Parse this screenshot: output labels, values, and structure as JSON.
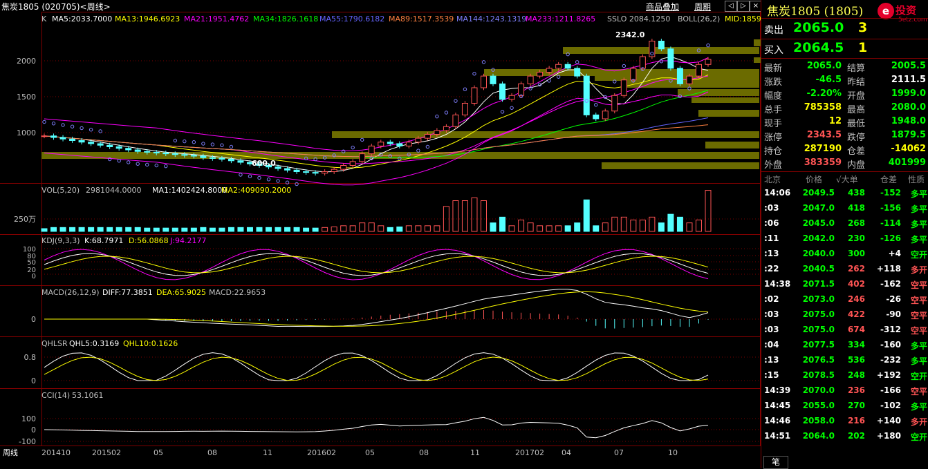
{
  "titlebar": {
    "title": "焦炭1805 (020705)<周线>",
    "btn_overlay": "商品叠加",
    "btn_period": "周期",
    "nav_left": "◁",
    "nav_right": "▷",
    "nav_close": "×"
  },
  "main_indicator": {
    "prefix": "K",
    "items": [
      {
        "text": "MA5:2033.7000",
        "color": "#ffffff"
      },
      {
        "text": "MA13:1946.6923",
        "color": "#ffff00"
      },
      {
        "text": "MA21:1951.4762",
        "color": "#ff00ff"
      },
      {
        "text": "MA34:1826.1618",
        "color": "#00ff00"
      },
      {
        "text": "MA55:1790.6182",
        "color": "#6464ff"
      },
      {
        "text": "MA89:1517.3539",
        "color": "#ff8040"
      },
      {
        "text": "MA144:1243.1319",
        "color": "#8080ff"
      },
      {
        "text": "MA233:1211.8265",
        "color": "#ff00ff"
      },
      {
        "text": "SSLO 2084.1250",
        "color": "#c0c0c0"
      },
      {
        "text": "BOLL(26,2)",
        "color": "#c0c0c0"
      },
      {
        "text": "MID:1859",
        "color": "#ffff00"
      }
    ],
    "yticks": [
      "2000",
      "1500",
      "1000"
    ],
    "annot_high": "2342.0",
    "annot_low": "600.0"
  },
  "vol": {
    "label": "VOL(5,20)",
    "v": "2981044.0000",
    "ma1": "MA1:1402424.8000",
    "ma2": "MA2:409090.2000",
    "ytick": "250万"
  },
  "kdj": {
    "label": "KDJ(9,3,3)",
    "k": "K:68.7971",
    "d": "D:56.0868",
    "j": "J:94.2177",
    "yticks": [
      "100",
      "80",
      "50",
      "20",
      "0"
    ]
  },
  "macd": {
    "label": "MACD(26,12,9)",
    "diff": "DIFF:77.3851",
    "dea": "DEA:65.9025",
    "macd": "MACD:22.9653",
    "ytick": "0"
  },
  "qhlsr": {
    "label": "QHLSR",
    "q5": "QHL5:0.3169",
    "q10": "QHL10:0.1626",
    "yticks": [
      "0.8",
      "0"
    ]
  },
  "cci": {
    "label": "CCI(14)",
    "val": "53.1061",
    "yticks": [
      "100",
      "0",
      "-100"
    ]
  },
  "xaxis": {
    "period": "周线",
    "labels": [
      "201410",
      "201502",
      "05",
      "08",
      "11",
      "201602",
      "05",
      "08",
      "11",
      "201702",
      "04",
      "07",
      "10"
    ]
  },
  "chart_data": {
    "type": "candlestick",
    "symbol": "焦炭1805",
    "period": "周线",
    "ylim": [
      500,
      2500
    ],
    "high_mark": 2342.0,
    "low_mark": 600.0,
    "close_path": [
      1080,
      1060,
      1040,
      1020,
      1000,
      980,
      960,
      940,
      920,
      900,
      880,
      870,
      860,
      850,
      840,
      830,
      820,
      800,
      790,
      780,
      760,
      740,
      720,
      700,
      680,
      660,
      640,
      620,
      610,
      600,
      620,
      650,
      700,
      750,
      850,
      950,
      1000,
      980,
      950,
      1000,
      1050,
      1100,
      1150,
      1200,
      1350,
      1500,
      1700,
      1850,
      1750,
      1550,
      1600,
      1750,
      1850,
      1900,
      1950,
      2000,
      1950,
      1850,
      1350,
      1300,
      1400,
      1600,
      1800,
      1950,
      2100,
      2300,
      2200,
      1950,
      1750,
      1850,
      2000,
      2065
    ]
  },
  "panel": {
    "name": "焦炭1805 (1805)",
    "logo_text": "投资",
    "logo_url": "5etz.com",
    "sell_label": "卖出",
    "sell_price": "2065.0",
    "sell_vol": "3",
    "buy_label": "买入",
    "buy_price": "2064.5",
    "buy_vol": "1",
    "quotes": [
      {
        "l1": "最新",
        "v1": "2065.0",
        "c1": "g",
        "l2": "结算",
        "v2": "2005.5",
        "c2": "g"
      },
      {
        "l1": "涨跌",
        "v1": "-46.5",
        "c1": "g",
        "l2": "昨结",
        "v2": "2111.5",
        "c2": "w"
      },
      {
        "l1": "幅度",
        "v1": "-2.20%",
        "c1": "g",
        "l2": "开盘",
        "v2": "1999.0",
        "c2": "g"
      },
      {
        "l1": "总手",
        "v1": "785358",
        "c1": "y",
        "l2": "最高",
        "v2": "2080.0",
        "c2": "g"
      },
      {
        "l1": "现手",
        "v1": "12",
        "c1": "y",
        "l2": "最低",
        "v2": "1948.0",
        "c2": "g"
      },
      {
        "l1": "涨停",
        "v1": "2343.5",
        "c1": "r",
        "l2": "跌停",
        "v2": "1879.5",
        "c2": "g"
      },
      {
        "l1": "持仓",
        "v1": "287190",
        "c1": "y",
        "l2": "仓差",
        "v2": "-14062",
        "c2": "y"
      },
      {
        "l1": "外盘",
        "v1": "383359",
        "c1": "r",
        "l2": "内盘",
        "v2": "401999",
        "c2": "g"
      }
    ],
    "thead": {
      "c1": "北京",
      "c2": "价格",
      "c3": "√大单",
      "c4": "仓差",
      "c5": "性质"
    },
    "trades": [
      {
        "t": "14:06",
        "p": "2049.5",
        "pc": "g",
        "v": "438",
        "vc": "g",
        "d": "-152",
        "dc": "g",
        "n": "多平",
        "nc": "g"
      },
      {
        "t": ":03",
        "p": "2047.0",
        "pc": "g",
        "v": "418",
        "vc": "g",
        "d": "-156",
        "dc": "g",
        "n": "多平",
        "nc": "g"
      },
      {
        "t": ":06",
        "p": "2045.0",
        "pc": "g",
        "v": "268",
        "vc": "g",
        "d": "-114",
        "dc": "g",
        "n": "多平",
        "nc": "g"
      },
      {
        "t": ":11",
        "p": "2042.0",
        "pc": "g",
        "v": "230",
        "vc": "g",
        "d": "-126",
        "dc": "g",
        "n": "多平",
        "nc": "g"
      },
      {
        "t": ":13",
        "p": "2040.0",
        "pc": "g",
        "v": "300",
        "vc": "g",
        "d": "+4",
        "dc": "w",
        "n": "空开",
        "nc": "g"
      },
      {
        "t": ":22",
        "p": "2040.5",
        "pc": "g",
        "v": "262",
        "vc": "r",
        "d": "+118",
        "dc": "w",
        "n": "多开",
        "nc": "r"
      },
      {
        "t": "14:38",
        "p": "2071.5",
        "pc": "g",
        "v": "402",
        "vc": "r",
        "d": "-162",
        "dc": "w",
        "n": "空平",
        "nc": "r"
      },
      {
        "t": ":02",
        "p": "2073.0",
        "pc": "g",
        "v": "246",
        "vc": "r",
        "d": "-26",
        "dc": "w",
        "n": "空平",
        "nc": "r"
      },
      {
        "t": ":03",
        "p": "2075.0",
        "pc": "g",
        "v": "422",
        "vc": "r",
        "d": "-90",
        "dc": "w",
        "n": "空平",
        "nc": "r"
      },
      {
        "t": ":03",
        "p": "2075.0",
        "pc": "g",
        "v": "674",
        "vc": "r",
        "d": "-312",
        "dc": "w",
        "n": "空平",
        "nc": "r"
      },
      {
        "t": ":04",
        "p": "2077.5",
        "pc": "g",
        "v": "334",
        "vc": "g",
        "d": "-160",
        "dc": "w",
        "n": "多平",
        "nc": "g"
      },
      {
        "t": ":13",
        "p": "2076.5",
        "pc": "g",
        "v": "536",
        "vc": "g",
        "d": "-232",
        "dc": "w",
        "n": "多平",
        "nc": "g"
      },
      {
        "t": ":15",
        "p": "2078.5",
        "pc": "g",
        "v": "248",
        "vc": "g",
        "d": "+192",
        "dc": "w",
        "n": "空开",
        "nc": "g"
      },
      {
        "t": "14:39",
        "p": "2070.0",
        "pc": "g",
        "v": "236",
        "vc": "r",
        "d": "-166",
        "dc": "w",
        "n": "空平",
        "nc": "r"
      },
      {
        "t": "14:45",
        "p": "2055.0",
        "pc": "g",
        "v": "270",
        "vc": "g",
        "d": "-102",
        "dc": "w",
        "n": "多平",
        "nc": "g"
      },
      {
        "t": "14:46",
        "p": "2058.0",
        "pc": "g",
        "v": "216",
        "vc": "r",
        "d": "+140",
        "dc": "w",
        "n": "多开",
        "nc": "r"
      },
      {
        "t": "14:51",
        "p": "2064.0",
        "pc": "g",
        "v": "202",
        "vc": "g",
        "d": "+180",
        "dc": "w",
        "n": "空开",
        "nc": "g"
      }
    ],
    "bottom_btn": "笔"
  }
}
